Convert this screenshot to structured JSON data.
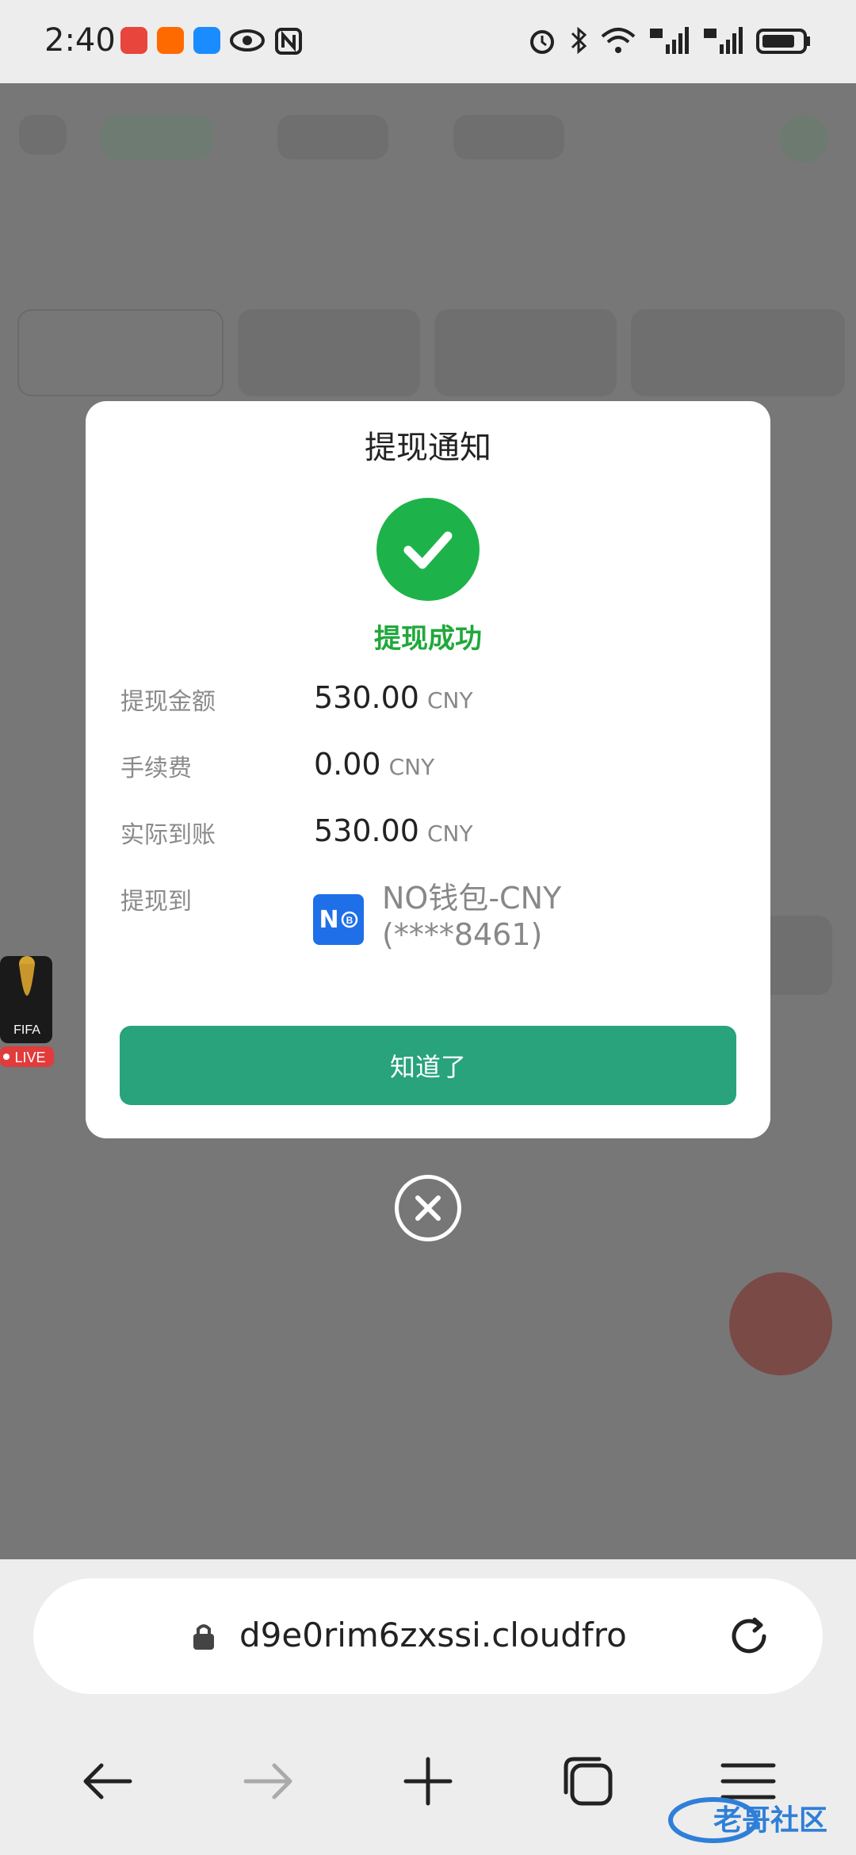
{
  "status_bar": {
    "time": "2:40"
  },
  "dialog": {
    "title": "提现通知",
    "success_text": "提现成功",
    "rows": [
      {
        "label": "提现金额",
        "value": "530.00",
        "unit": "CNY"
      },
      {
        "label": "手续费",
        "value": "0.00",
        "unit": "CNY"
      },
      {
        "label": "实际到账",
        "value": "530.00",
        "unit": "CNY"
      }
    ],
    "destination_label": "提现到",
    "wallet_logo_text": "N",
    "wallet_name_line1": "NO钱包-CNY",
    "wallet_name_line2": "(****8461)",
    "confirm_label": "知道了"
  },
  "side_badge": {
    "text": "FIFA",
    "live": "LIVE"
  },
  "browser": {
    "url": "d9e0rim6zxssi.cloudfro"
  },
  "watermark": "老哥社区",
  "colors": {
    "primary": "#28a37c",
    "success": "#1eb34a",
    "overlay": "#777777"
  }
}
